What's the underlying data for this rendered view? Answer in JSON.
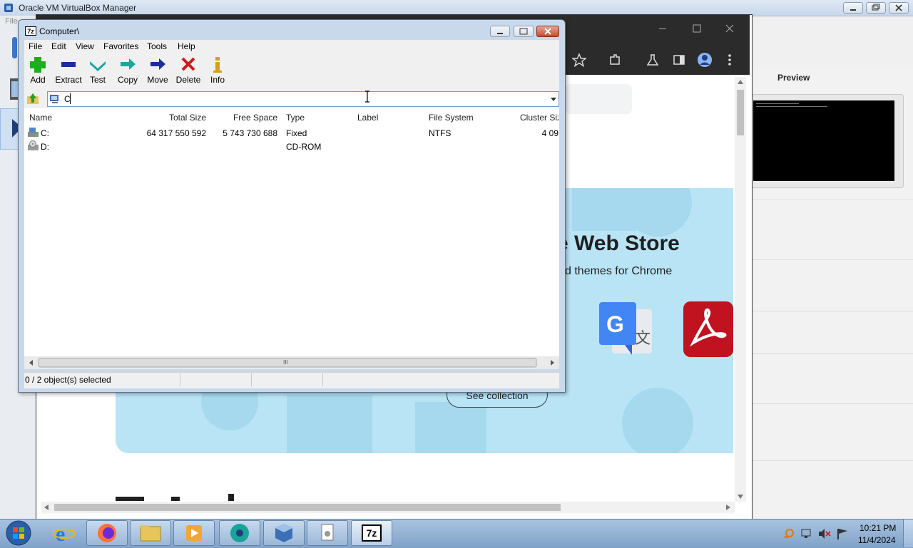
{
  "vbox": {
    "title": "Oracle VM VirtualBox Manager",
    "menu_partial": "File",
    "preview_label": "Preview"
  },
  "chrome": {
    "store_title": "e Web Store",
    "store_subtitle": "d themes for Chrome",
    "see_collection": "See collection"
  },
  "zip": {
    "title": "Computer\\",
    "title_icon": "7z",
    "menu": [
      "File",
      "Edit",
      "View",
      "Favorites",
      "Tools",
      "Help"
    ],
    "toolbar": [
      "Add",
      "Extract",
      "Test",
      "Copy",
      "Move",
      "Delete",
      "Info"
    ],
    "path": "C",
    "columns": [
      "Name",
      "Total Size",
      "Free Space",
      "Type",
      "Label",
      "File System",
      "Cluster Siz"
    ],
    "rows": [
      {
        "name": "C:",
        "total": "64 317 550 592",
        "free": "5 743 730 688",
        "type": "Fixed",
        "label": "",
        "fs": "NTFS",
        "cluster": "4 09"
      },
      {
        "name": "D:",
        "total": "",
        "free": "",
        "type": "CD-ROM",
        "label": "",
        "fs": "",
        "cluster": ""
      }
    ],
    "status": "0 / 2 object(s) selected",
    "scroll_grip": "III"
  },
  "taskbar": {
    "apps": [
      "internet-explorer",
      "firefox",
      "file-explorer",
      "media-player",
      "chrome-like",
      "virtualbox",
      "document",
      "7zip"
    ],
    "zip_label": "7z",
    "time": "10:21 PM",
    "date": "11/4/2024"
  },
  "colors": {
    "banner": "#b9e4f6",
    "taskbar": "#8fb0d4",
    "delete_red": "#cc1a1a",
    "add_green": "#1cae1c",
    "nav_blue": "#1a2e9c"
  }
}
